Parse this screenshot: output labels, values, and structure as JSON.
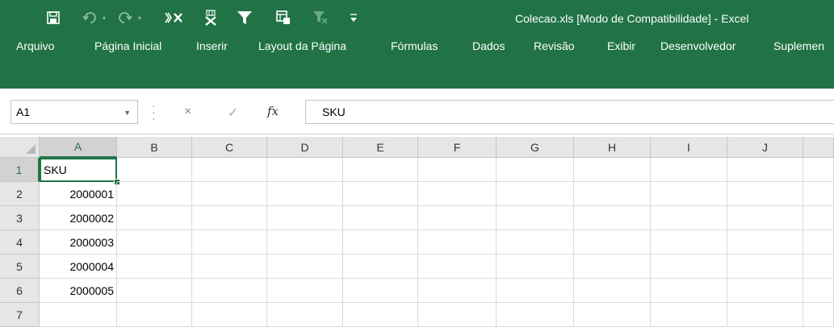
{
  "colors": {
    "ribbon": "#217346",
    "header_bg": "#e6e6e6",
    "selected_header": "#d2d2d2",
    "accent": "#217346"
  },
  "qat": {
    "icons": [
      "save-icon",
      "undo-icon",
      "redo-icon",
      "delete-column-icon",
      "remove-duplicates-icon",
      "filter-icon",
      "table-format-icon",
      "clear-filter-icon",
      "customize-qat-icon"
    ]
  },
  "window": {
    "title": "Colecao.xls  [Modo de Compatibilidade] - Excel"
  },
  "menu": {
    "items": [
      "Arquivo",
      "Página Inicial",
      "Inserir",
      "Layout da Página",
      "Fórmulas",
      "Dados",
      "Revisão",
      "Exibir",
      "Desenvolvedor",
      "Suplemen"
    ]
  },
  "formula_bar": {
    "name_box": "A1",
    "cancel_icon": "×",
    "enter_icon": "✓",
    "fx_label": "fx",
    "content": "SKU"
  },
  "sheet": {
    "columns": [
      "A",
      "B",
      "C",
      "D",
      "E",
      "F",
      "G",
      "H",
      "I",
      "J"
    ],
    "rows": [
      "1",
      "2",
      "3",
      "4",
      "5",
      "6",
      "7"
    ],
    "active_cell": "A1",
    "cells": {
      "A1": "SKU",
      "A2": "2000001",
      "A3": "2000002",
      "A4": "2000003",
      "A5": "2000004",
      "A6": "2000005"
    }
  }
}
